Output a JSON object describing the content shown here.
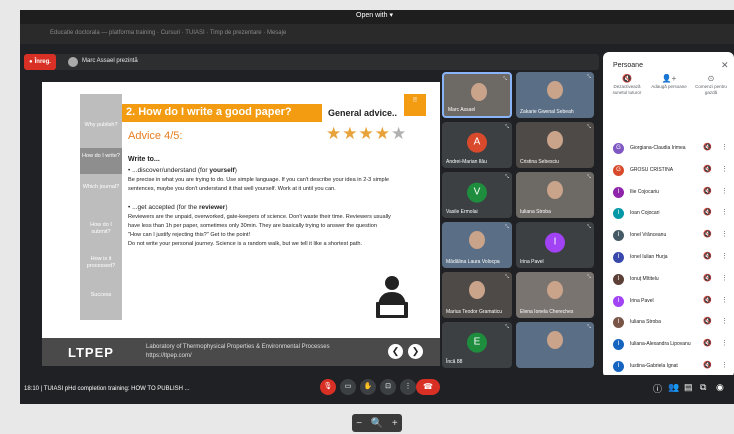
{
  "top": {
    "open_with": "Open with ▾",
    "tabs": "Educatie doctorala — platforma training · Cursuri · TUIASI · Timp de prezentare · Mesaje"
  },
  "presenting": {
    "rec_label": "Înreg.",
    "text": "Marc Assael prezintă"
  },
  "slide": {
    "sidebar": [
      "Why publish?",
      "How do I write?",
      "Which journal?",
      "How do I submit?",
      "How is it processed?",
      "Success"
    ],
    "title": "2. How do I write a good paper?",
    "subtitle": "General advice..",
    "corner": "!!",
    "advice": "Advice 4/5:",
    "stars_on": "★★★★",
    "stars_off": "★",
    "write_to": "Write to...",
    "b1a": "• ...discover/understand (for ",
    "b1b": "yourself",
    "b1c": ")",
    "p1a": "Be precise in what you are trying to do. Use simple language. If you can't describe your idea in 2-3 simple",
    "p1b": "sentences, maybe you don't understand it that well yourself. Work at it until you can.",
    "b2a": "• ...get accepted (for the ",
    "b2b": "reviewer",
    "b2c": ")",
    "p2a": "Reviewers are the unpaid, overworked, gate-keepers of science. Don't waste their time. Reviewers usually",
    "p2b": "have less than 1h per paper, sometimes only 30min. They are basically trying to answer the question",
    "p2c": "\"How can I justify rejecting this?\" Get to the point!",
    "p2d": "Do not write your personal journey. Science is a random walk, but we tell it like a shortest path.",
    "logo": "LTPEP",
    "lab1": "Laboratory of Thermophysical Properties & Environmental Processes",
    "lab2": "https://ltpep.com/",
    "prev": "❮",
    "next": "❯"
  },
  "tiles": [
    {
      "name": "Marc Assael",
      "type": "video"
    },
    {
      "name": "Zakarie Gwenal Sebeah",
      "type": "video"
    },
    {
      "name": "Andrei-Marian Ilău",
      "type": "avatar",
      "initial": "A",
      "color": "#d84a2b"
    },
    {
      "name": "Cristina Sebesciu",
      "type": "video"
    },
    {
      "name": "Vasile Ermolai",
      "type": "avatar",
      "initial": "V",
      "color": "#1e8e3e"
    },
    {
      "name": "Iuliana Stroba",
      "type": "video"
    },
    {
      "name": "Mădălina Laura Volocpa",
      "type": "video"
    },
    {
      "name": "Irina Pavel",
      "type": "avatar",
      "initial": "I",
      "color": "#a142f4"
    },
    {
      "name": "Marius Teodor Gramaticu",
      "type": "video"
    },
    {
      "name": "Elena Ionela Chereches",
      "type": "video"
    },
    {
      "name": "Încă 88",
      "type": "more"
    },
    {
      "name": "",
      "type": "video"
    }
  ],
  "panel": {
    "title": "Persoane",
    "close": "✕",
    "actions": [
      {
        "icon": "🔇",
        "label": "Dezactivează sunetul tuturor"
      },
      {
        "icon": "👤+",
        "label": "Adaugă persoane"
      },
      {
        "icon": "⊙",
        "label": "Comenzi pentru gazdă"
      }
    ],
    "people": [
      {
        "name": "Giorgiana-Claudia Irimea",
        "initial": "G",
        "color": "#7e57c2"
      },
      {
        "name": "GROSU CRISTINA",
        "initial": "G",
        "color": "#d84a2b"
      },
      {
        "name": "Ilie Cojocariu",
        "initial": "I",
        "color": "#8e24aa"
      },
      {
        "name": "Ioan Cojocari",
        "initial": "I",
        "color": "#0097a7"
      },
      {
        "name": "Ionel Vrănceanu",
        "initial": "I",
        "color": "#455a64"
      },
      {
        "name": "Ionel Iulian Hurja",
        "initial": "I",
        "color": "#3949ab"
      },
      {
        "name": "Ionuț Mîtitelu",
        "initial": "I",
        "color": "#5d4037"
      },
      {
        "name": "Irina Pavel",
        "initial": "I",
        "color": "#a142f4"
      },
      {
        "name": "Iuliana Stroba",
        "initial": "I",
        "color": "#795548"
      },
      {
        "name": "Iuliana-Alexandra Lipovanu",
        "initial": "I",
        "color": "#1565c0"
      },
      {
        "name": "Iustina-Gabriela Ignat",
        "initial": "I",
        "color": "#1565c0"
      }
    ],
    "mic": "🔇",
    "more": "⋮"
  },
  "bottom": {
    "meeting": "18:10  |  TUIASI pHd completion training: HOW TO PUBLISH ..."
  },
  "zoom": {
    "minus": "−",
    "search": "🔍",
    "plus": "+"
  }
}
